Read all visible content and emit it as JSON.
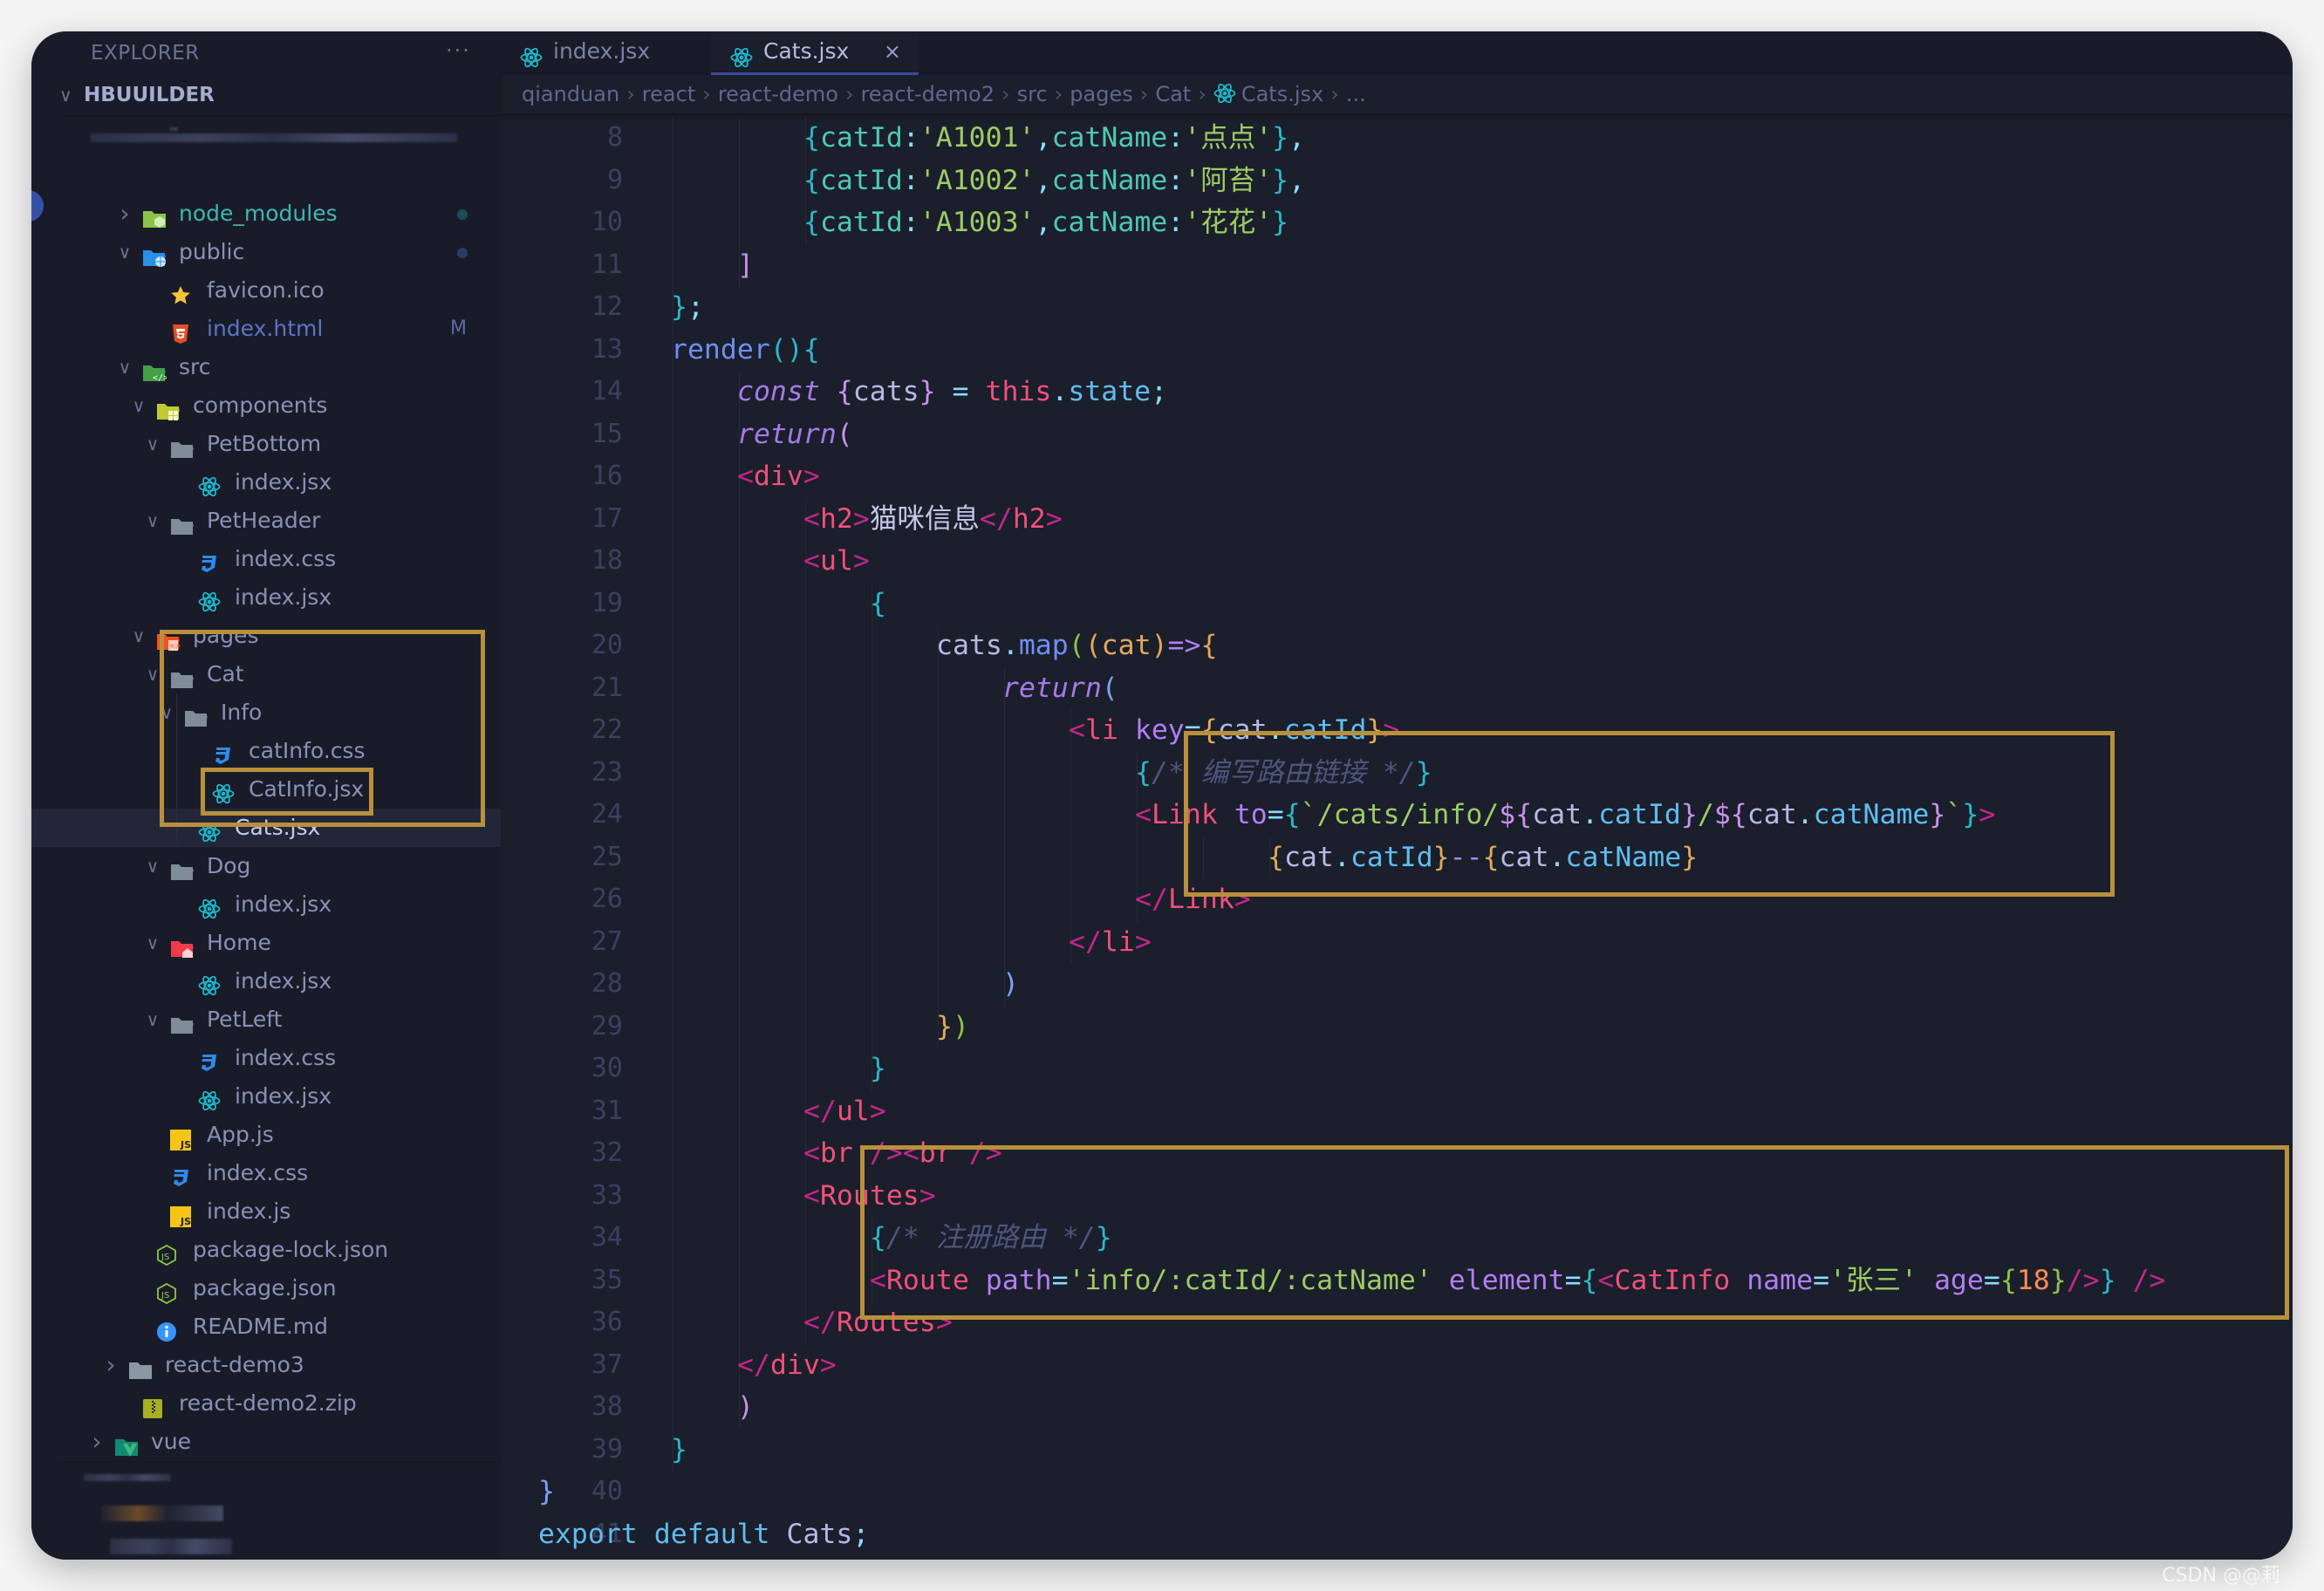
{
  "sidebar": {
    "title": "EXPLORER",
    "more_label": "···",
    "section": "HBUUILDER",
    "tree": [
      {
        "label": "node_modules",
        "depth": 1,
        "kind": "folder-node",
        "chevron": "right",
        "color": "#3fb6b3",
        "dot": "#1f4b56"
      },
      {
        "label": "public",
        "depth": 1,
        "kind": "folder-public",
        "chevron": "down",
        "dot": "#2d3a64"
      },
      {
        "label": "favicon.ico",
        "depth": 2,
        "kind": "favicon"
      },
      {
        "label": "index.html",
        "depth": 2,
        "kind": "html",
        "badge": "M",
        "color": "#5a74c8"
      },
      {
        "label": "src",
        "depth": 1,
        "kind": "folder-src",
        "chevron": "down"
      },
      {
        "label": "components",
        "depth": 2,
        "kind": "folder-components",
        "chevron": "down"
      },
      {
        "label": "PetBottom",
        "depth": 3,
        "kind": "folder",
        "chevron": "down"
      },
      {
        "label": "index.jsx",
        "depth": 4,
        "kind": "react"
      },
      {
        "label": "PetHeader",
        "depth": 3,
        "kind": "folder",
        "chevron": "down"
      },
      {
        "label": "index.css",
        "depth": 4,
        "kind": "css"
      },
      {
        "label": "index.jsx",
        "depth": 4,
        "kind": "react"
      },
      {
        "label": "pages",
        "depth": 2,
        "kind": "folder-pages",
        "chevron": "down"
      },
      {
        "label": "Cat",
        "depth": 3,
        "kind": "folder",
        "chevron": "down"
      },
      {
        "label": "Info",
        "depth": 4,
        "kind": "folder",
        "chevron": "down"
      },
      {
        "label": "catInfo.css",
        "depth": 5,
        "kind": "css"
      },
      {
        "label": "CatInfo.jsx",
        "depth": 5,
        "kind": "react"
      },
      {
        "label": "Cats.jsx",
        "depth": 4,
        "kind": "react",
        "active": true
      },
      {
        "label": "Dog",
        "depth": 3,
        "kind": "folder",
        "chevron": "down"
      },
      {
        "label": "index.jsx",
        "depth": 4,
        "kind": "react"
      },
      {
        "label": "Home",
        "depth": 3,
        "kind": "folder-home",
        "chevron": "down"
      },
      {
        "label": "index.jsx",
        "depth": 4,
        "kind": "react"
      },
      {
        "label": "PetLeft",
        "depth": 3,
        "kind": "folder",
        "chevron": "down"
      },
      {
        "label": "index.css",
        "depth": 4,
        "kind": "css"
      },
      {
        "label": "index.jsx",
        "depth": 4,
        "kind": "react"
      },
      {
        "label": "App.js",
        "depth": 2,
        "kind": "js"
      },
      {
        "label": "index.css",
        "depth": 2,
        "kind": "css"
      },
      {
        "label": "index.js",
        "depth": 2,
        "kind": "js"
      },
      {
        "label": "package-lock.json",
        "depth": 1,
        "kind": "node"
      },
      {
        "label": "package.json",
        "depth": 1,
        "kind": "node"
      },
      {
        "label": "README.md",
        "depth": 1,
        "kind": "info"
      },
      {
        "label": "react-demo3",
        "depth": 0,
        "kind": "folder-closed",
        "chevron": "right"
      },
      {
        "label": "react-demo2.zip",
        "depth": 0,
        "kind": "zip"
      },
      {
        "label": "vue",
        "depth": -1,
        "kind": "folder-vue",
        "chevron": "right"
      }
    ]
  },
  "tabs": [
    {
      "label": "index.jsx",
      "active": false
    },
    {
      "label": "Cats.jsx",
      "active": true,
      "close": "×"
    }
  ],
  "breadcrumb": [
    "qianduan",
    "react",
    "react-demo",
    "react-demo2",
    "src",
    "pages",
    "Cat",
    "Cats.jsx",
    "..."
  ],
  "code": {
    "first_line": 8,
    "lines": [
      {
        "indent": 4,
        "tokens": [
          [
            "{",
            "t-br1"
          ],
          [
            "catId",
            "t-prop"
          ],
          [
            ":",
            "t-punc"
          ],
          [
            "'A1001'",
            "t-str"
          ],
          [
            ",",
            "t-punc"
          ],
          [
            "catName",
            "t-prop"
          ],
          [
            ":",
            "t-punc"
          ],
          [
            "'点点'",
            "t-str"
          ],
          [
            "}",
            "t-br1"
          ],
          [
            ",",
            "t-punc"
          ]
        ]
      },
      {
        "indent": 4,
        "tokens": [
          [
            "{",
            "t-br1"
          ],
          [
            "catId",
            "t-prop"
          ],
          [
            ":",
            "t-punc"
          ],
          [
            "'A1002'",
            "t-str"
          ],
          [
            ",",
            "t-punc"
          ],
          [
            "catName",
            "t-prop"
          ],
          [
            ":",
            "t-punc"
          ],
          [
            "'阿苔'",
            "t-str"
          ],
          [
            "}",
            "t-br1"
          ],
          [
            ",",
            "t-punc"
          ]
        ]
      },
      {
        "indent": 4,
        "tokens": [
          [
            "{",
            "t-br1"
          ],
          [
            "catId",
            "t-prop"
          ],
          [
            ":",
            "t-punc"
          ],
          [
            "'A1003'",
            "t-str"
          ],
          [
            ",",
            "t-punc"
          ],
          [
            "catName",
            "t-prop"
          ],
          [
            ":",
            "t-punc"
          ],
          [
            "'花花'",
            "t-str"
          ],
          [
            "}",
            "t-br1"
          ]
        ]
      },
      {
        "indent": 3,
        "tokens": [
          [
            "]",
            "t-br2"
          ]
        ]
      },
      {
        "indent": 2,
        "tokens": [
          [
            "}",
            "t-br1"
          ],
          [
            ";",
            "t-punc"
          ]
        ]
      },
      {
        "indent": 2,
        "tokens": [
          [
            "render",
            "t-fn"
          ],
          [
            "()",
            "t-br1"
          ],
          [
            "{",
            "t-br1"
          ]
        ]
      },
      {
        "indent": 3,
        "tokens": [
          [
            "const",
            "t-kw"
          ],
          [
            " ",
            ""
          ],
          [
            "{",
            "t-br2"
          ],
          [
            "cats",
            "t-var"
          ],
          [
            "}",
            "t-br2"
          ],
          [
            " = ",
            "t-punc"
          ],
          [
            "this",
            "t-this"
          ],
          [
            ".",
            "t-punc"
          ],
          [
            "state",
            "t-member"
          ],
          [
            ";",
            "t-punc"
          ]
        ]
      },
      {
        "indent": 3,
        "tokens": [
          [
            "return",
            "t-kw"
          ],
          [
            "(",
            "t-br2"
          ]
        ]
      },
      {
        "indent": 3,
        "tokens": [
          [
            "<",
            "t-tagp"
          ],
          [
            "div",
            "t-tag"
          ],
          [
            ">",
            "t-tagp"
          ]
        ]
      },
      {
        "indent": 4,
        "tokens": [
          [
            "<",
            "t-tagp"
          ],
          [
            "h2",
            "t-tag"
          ],
          [
            ">",
            "t-tagp"
          ],
          [
            "猫咪信息",
            "t-text"
          ],
          [
            "</",
            "t-tagp"
          ],
          [
            "h2",
            "t-tag"
          ],
          [
            ">",
            "t-tagp"
          ]
        ]
      },
      {
        "indent": 4,
        "tokens": [
          [
            "<",
            "t-tagp"
          ],
          [
            "ul",
            "t-tag"
          ],
          [
            ">",
            "t-tagp"
          ]
        ]
      },
      {
        "indent": 5,
        "tokens": [
          [
            "{",
            "t-br1"
          ]
        ]
      },
      {
        "indent": 6,
        "tokens": [
          [
            "cats",
            "t-var"
          ],
          [
            ".",
            "t-punc"
          ],
          [
            "map",
            "t-fn"
          ],
          [
            "(",
            "t-br5"
          ],
          [
            "(",
            "t-br3"
          ],
          [
            "cat",
            "t-br3"
          ],
          [
            ")",
            "t-br3"
          ],
          [
            "=>",
            "t-attr"
          ],
          [
            "{",
            "t-br3"
          ]
        ]
      },
      {
        "indent": 7,
        "tokens": [
          [
            "return",
            "t-kw"
          ],
          [
            "(",
            "t-br4"
          ]
        ]
      },
      {
        "indent": 8,
        "tokens": [
          [
            "<",
            "t-tagp"
          ],
          [
            "li",
            "t-tag"
          ],
          [
            " ",
            ""
          ],
          [
            "key",
            "t-attr"
          ],
          [
            "=",
            "t-punc"
          ],
          [
            "{",
            "t-br3"
          ],
          [
            "cat",
            "t-var"
          ],
          [
            ".",
            "t-punc"
          ],
          [
            "catId",
            "t-member"
          ],
          [
            "}",
            "t-br3"
          ],
          [
            ">",
            "t-tagp"
          ]
        ]
      },
      {
        "indent": 9,
        "tokens": [
          [
            "{",
            "t-br1"
          ],
          [
            "/* 编写路由链接 */",
            "t-cmt"
          ],
          [
            "}",
            "t-br1"
          ]
        ]
      },
      {
        "indent": 9,
        "tokens": [
          [
            "<",
            "t-tagp"
          ],
          [
            "Link",
            "t-tag"
          ],
          [
            " ",
            ""
          ],
          [
            "to",
            "t-attr"
          ],
          [
            "=",
            "t-punc"
          ],
          [
            "{",
            "t-br1"
          ],
          [
            "`/cats/info/",
            "t-str"
          ],
          [
            "${",
            "t-br2"
          ],
          [
            "cat",
            "t-var"
          ],
          [
            ".",
            "t-punc"
          ],
          [
            "catId",
            "t-member"
          ],
          [
            "}",
            "t-br2"
          ],
          [
            "/",
            "t-str"
          ],
          [
            "${",
            "t-br2"
          ],
          [
            "cat",
            "t-var"
          ],
          [
            ".",
            "t-punc"
          ],
          [
            "catName",
            "t-member"
          ],
          [
            "}",
            "t-br2"
          ],
          [
            "`",
            "t-str"
          ],
          [
            "}",
            "t-br1"
          ],
          [
            ">",
            "t-tagp"
          ]
        ]
      },
      {
        "indent": 11,
        "tokens": [
          [
            "{",
            "t-br3"
          ],
          [
            "cat",
            "t-var"
          ],
          [
            ".",
            "t-punc"
          ],
          [
            "catId",
            "t-member"
          ],
          [
            "}",
            "t-br3"
          ],
          [
            "--",
            "t-attr"
          ],
          [
            "{",
            "t-br3"
          ],
          [
            "cat",
            "t-var"
          ],
          [
            ".",
            "t-punc"
          ],
          [
            "catName",
            "t-member"
          ],
          [
            "}",
            "t-br3"
          ]
        ]
      },
      {
        "indent": 9,
        "tokens": [
          [
            "</",
            "t-tagp"
          ],
          [
            "Link",
            "t-tag"
          ],
          [
            ">",
            "t-tagp"
          ]
        ]
      },
      {
        "indent": 8,
        "tokens": [
          [
            "</",
            "t-tagp"
          ],
          [
            "li",
            "t-tag"
          ],
          [
            ">",
            "t-tagp"
          ]
        ]
      },
      {
        "indent": 7,
        "tokens": [
          [
            ")",
            "t-br4"
          ]
        ]
      },
      {
        "indent": 6,
        "tokens": [
          [
            "}",
            "t-br3"
          ],
          [
            ")",
            "t-br5"
          ]
        ]
      },
      {
        "indent": 5,
        "tokens": [
          [
            "}",
            "t-br1"
          ]
        ]
      },
      {
        "indent": 4,
        "tokens": [
          [
            "</",
            "t-tagp"
          ],
          [
            "ul",
            "t-tag"
          ],
          [
            ">",
            "t-tagp"
          ]
        ]
      },
      {
        "indent": 4,
        "tokens": [
          [
            "<",
            "t-tagp"
          ],
          [
            "br",
            "t-tag"
          ],
          [
            " />",
            "t-tagp"
          ],
          [
            "<",
            "t-tagp"
          ],
          [
            "br",
            "t-tag"
          ],
          [
            " />",
            "t-tagp"
          ]
        ]
      },
      {
        "indent": 4,
        "tokens": [
          [
            "<",
            "t-tagp"
          ],
          [
            "Routes",
            "t-tag"
          ],
          [
            ">",
            "t-tagp"
          ]
        ]
      },
      {
        "indent": 5,
        "tokens": [
          [
            "{",
            "t-br1"
          ],
          [
            "/* 注册路由 */",
            "t-cmt"
          ],
          [
            "}",
            "t-br1"
          ]
        ]
      },
      {
        "indent": 5,
        "tokens": [
          [
            "<",
            "t-tagp"
          ],
          [
            "Route",
            "t-tag"
          ],
          [
            " ",
            ""
          ],
          [
            "path",
            "t-attr"
          ],
          [
            "=",
            "t-punc"
          ],
          [
            "'info/:catId/:catName'",
            "t-str"
          ],
          [
            " ",
            ""
          ],
          [
            "element",
            "t-attr"
          ],
          [
            "=",
            "t-punc"
          ],
          [
            "{",
            "t-br1"
          ],
          [
            "<",
            "t-tagp"
          ],
          [
            "CatInfo",
            "t-tag"
          ],
          [
            " ",
            ""
          ],
          [
            "name",
            "t-attr"
          ],
          [
            "=",
            "t-punc"
          ],
          [
            "'张三'",
            "t-str"
          ],
          [
            " ",
            ""
          ],
          [
            "age",
            "t-attr"
          ],
          [
            "=",
            "t-punc"
          ],
          [
            "{",
            "t-br5"
          ],
          [
            "18",
            "t-num"
          ],
          [
            "}",
            "t-br5"
          ],
          [
            "/>",
            "t-tagp"
          ],
          [
            "}",
            "t-br1"
          ],
          [
            " ",
            ""
          ],
          [
            "/>",
            "t-tagp"
          ]
        ]
      },
      {
        "indent": 4,
        "tokens": [
          [
            "</",
            "t-tagp"
          ],
          [
            "Routes",
            "t-tag"
          ],
          [
            ">",
            "t-tagp"
          ]
        ]
      },
      {
        "indent": 3,
        "tokens": [
          [
            "</",
            "t-tagp"
          ],
          [
            "div",
            "t-tag"
          ],
          [
            ">",
            "t-tagp"
          ]
        ]
      },
      {
        "indent": 3,
        "tokens": [
          [
            ")",
            "t-br2"
          ]
        ]
      },
      {
        "indent": 2,
        "tokens": [
          [
            "}",
            "t-br1"
          ]
        ]
      },
      {
        "indent": 0,
        "tokens": [
          [
            "}",
            "t-br4"
          ]
        ]
      },
      {
        "indent": 0,
        "tokens": [
          [
            "export",
            "t-exp"
          ],
          [
            " ",
            ""
          ],
          [
            "default",
            "t-exp"
          ],
          [
            " ",
            ""
          ],
          [
            "Cats",
            "t-var"
          ],
          [
            ";",
            "t-punc"
          ]
        ]
      }
    ]
  },
  "highlights": {
    "color": "#b8903c",
    "boxes": [
      "sidebar-cat-folder",
      "sidebar-cats-file",
      "code-link-block",
      "code-routes-block"
    ]
  },
  "watermark": "CSDN @@莉"
}
